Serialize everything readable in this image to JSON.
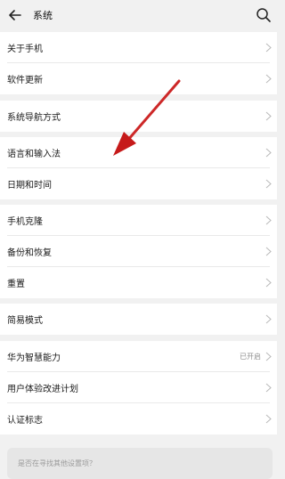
{
  "header": {
    "title": "系统",
    "back_icon": "back-arrow-icon",
    "search_icon": "search-icon"
  },
  "groups": [
    {
      "items": [
        {
          "label": "关于手机"
        },
        {
          "label": "软件更新"
        }
      ]
    },
    {
      "items": [
        {
          "label": "系统导航方式"
        }
      ]
    },
    {
      "items": [
        {
          "label": "语言和输入法"
        },
        {
          "label": "日期和时间"
        }
      ]
    },
    {
      "items": [
        {
          "label": "手机克隆"
        },
        {
          "label": "备份和恢复"
        },
        {
          "label": "重置"
        }
      ]
    },
    {
      "items": [
        {
          "label": "简易模式"
        }
      ]
    },
    {
      "items": [
        {
          "label": "华为智慧能力",
          "status": "已开启"
        },
        {
          "label": "用户体验改进计划"
        },
        {
          "label": "认证标志"
        }
      ]
    }
  ],
  "suggest": {
    "text": "是否在寻找其他设置项？"
  },
  "annotation": {
    "color": "#d32020"
  }
}
